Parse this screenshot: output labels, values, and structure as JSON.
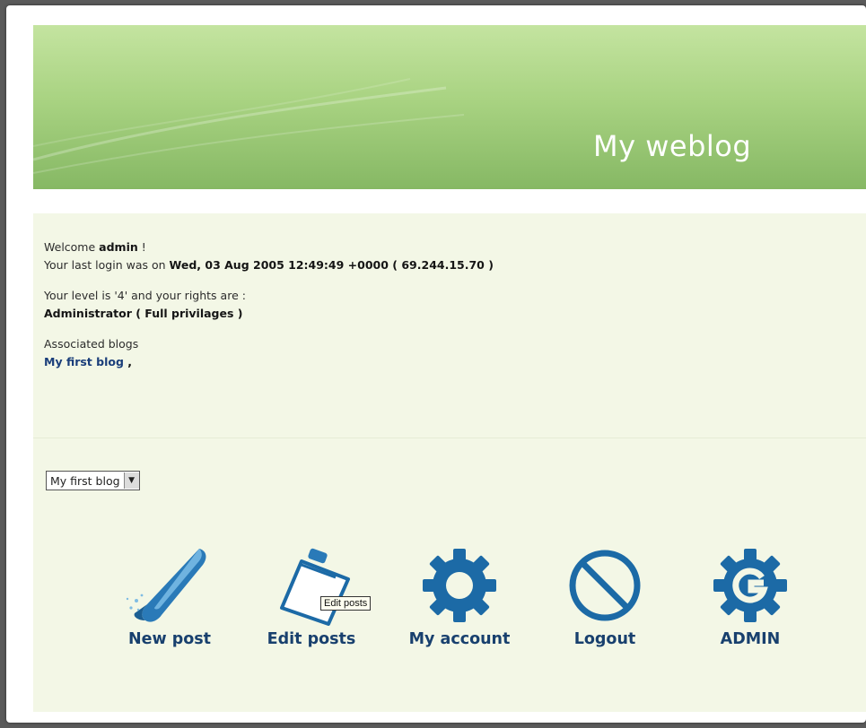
{
  "header": {
    "title": "My weblog"
  },
  "welcome": {
    "prefix": "Welcome ",
    "user": "admin",
    "suffix": " !",
    "last_login_prefix": "Your last login was on ",
    "last_login_value": "Wed, 03 Aug 2005 12:49:49 +0000 ( 69.244.15.70 )",
    "level_text": "Your level is '4' and your rights are :",
    "rights": "Administrator ( Full privilages )",
    "associated_label": "Associated blogs",
    "associated_blog": "My first blog",
    "associated_sep": " ,"
  },
  "blog_select": {
    "selected": "My first blog"
  },
  "tools": [
    {
      "label": "New post",
      "icon": "quill-pen-icon"
    },
    {
      "label": "Edit posts",
      "icon": "clipboard-icon"
    },
    {
      "label": "My account",
      "icon": "gear-icon"
    },
    {
      "label": "Logout",
      "icon": "no-entry-icon"
    },
    {
      "label": "ADMIN",
      "icon": "admin-gear-g-icon"
    }
  ],
  "tooltip": {
    "text": "Edit posts"
  },
  "colors": {
    "accent": "#1a6aa4",
    "header_green": "#a9d382",
    "label_blue": "#18406e"
  }
}
